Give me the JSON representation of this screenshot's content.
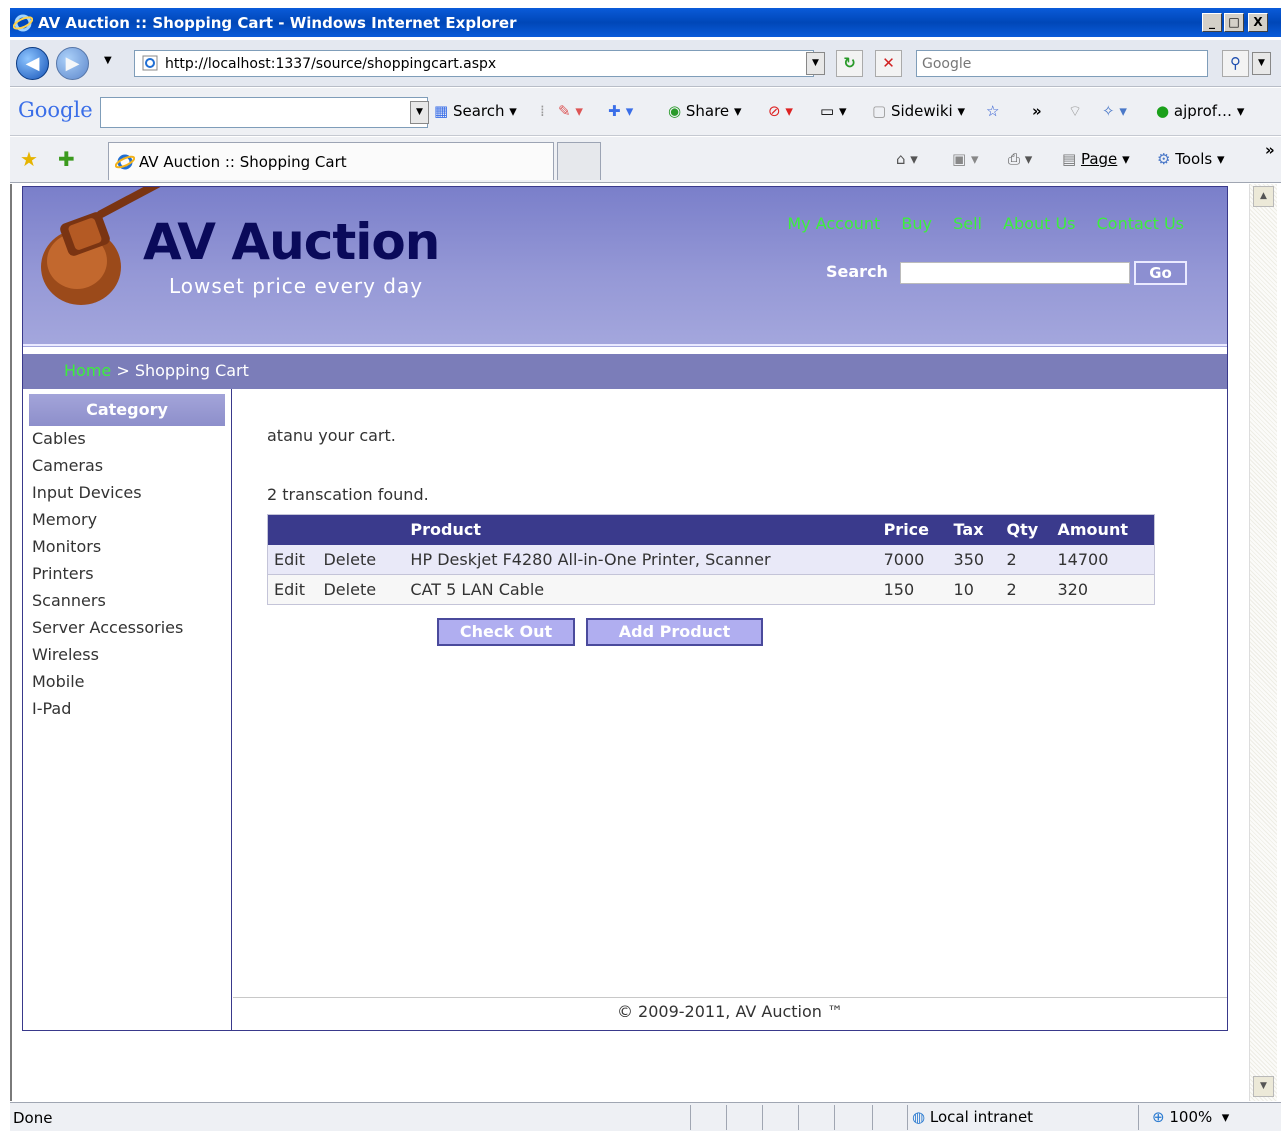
{
  "window": {
    "title": "AV Auction :: Shopping Cart - Windows Internet Explorer",
    "minimize": "_",
    "maximize": "□",
    "close": "X"
  },
  "navbar": {
    "url": "http://localhost:1337/source/shoppingcart.aspx",
    "search_placeholder": "Google"
  },
  "google_toolbar": {
    "logo": "Google",
    "search_label": "Search",
    "share_label": "Share",
    "sidewiki_label": "Sidewiki",
    "more": "»",
    "profile_label": "ajprof…"
  },
  "favorites_bar": {
    "tab_title": "AV Auction :: Shopping Cart",
    "page_label": "Page",
    "tools_label": "Tools",
    "more": "»"
  },
  "site": {
    "title": "AV Auction",
    "tagline": "Lowset price every day",
    "nav": [
      "My Account",
      "Buy",
      "Sell",
      "About Us",
      "Contact Us"
    ],
    "search_label": "Search",
    "go_label": "Go"
  },
  "breadcrumb": {
    "home": "Home",
    "separator": ">",
    "current": "Shopping Cart"
  },
  "sidebar": {
    "heading": "Category",
    "items": [
      "Cables",
      "Cameras",
      "Input Devices",
      "Memory",
      "Monitors",
      "Printers",
      "Scanners",
      "Server Accessories",
      "Wireless",
      "Mobile",
      "I-Pad"
    ]
  },
  "cart": {
    "greeting": "atanu your cart.",
    "found_text": "2 transcation found.",
    "columns": [
      "",
      "",
      "Product",
      "Price",
      "Tax",
      "Qty",
      "Amount"
    ],
    "rows": [
      {
        "edit": "Edit",
        "delete": "Delete",
        "product": "HP Deskjet F4280 All-in-One Printer, Scanner",
        "price": "7000",
        "tax": "350",
        "qty": "2",
        "amount": "14700"
      },
      {
        "edit": "Edit",
        "delete": "Delete",
        "product": "CAT 5 LAN Cable",
        "price": "150",
        "tax": "10",
        "qty": "2",
        "amount": "320"
      }
    ],
    "checkout_label": "Check Out",
    "add_product_label": "Add Product"
  },
  "footer": {
    "text": "© 2009-2011, AV Auction ™"
  },
  "statusbar": {
    "status": "Done",
    "zone": "Local intranet",
    "zoom": "100%"
  },
  "colors": {
    "title_bar": "#0a5bd9",
    "header_purple": "#9598d6",
    "nav_link_green": "#3cef3c",
    "table_header": "#3a3a8c",
    "button_lilac": "#b0aef0"
  }
}
